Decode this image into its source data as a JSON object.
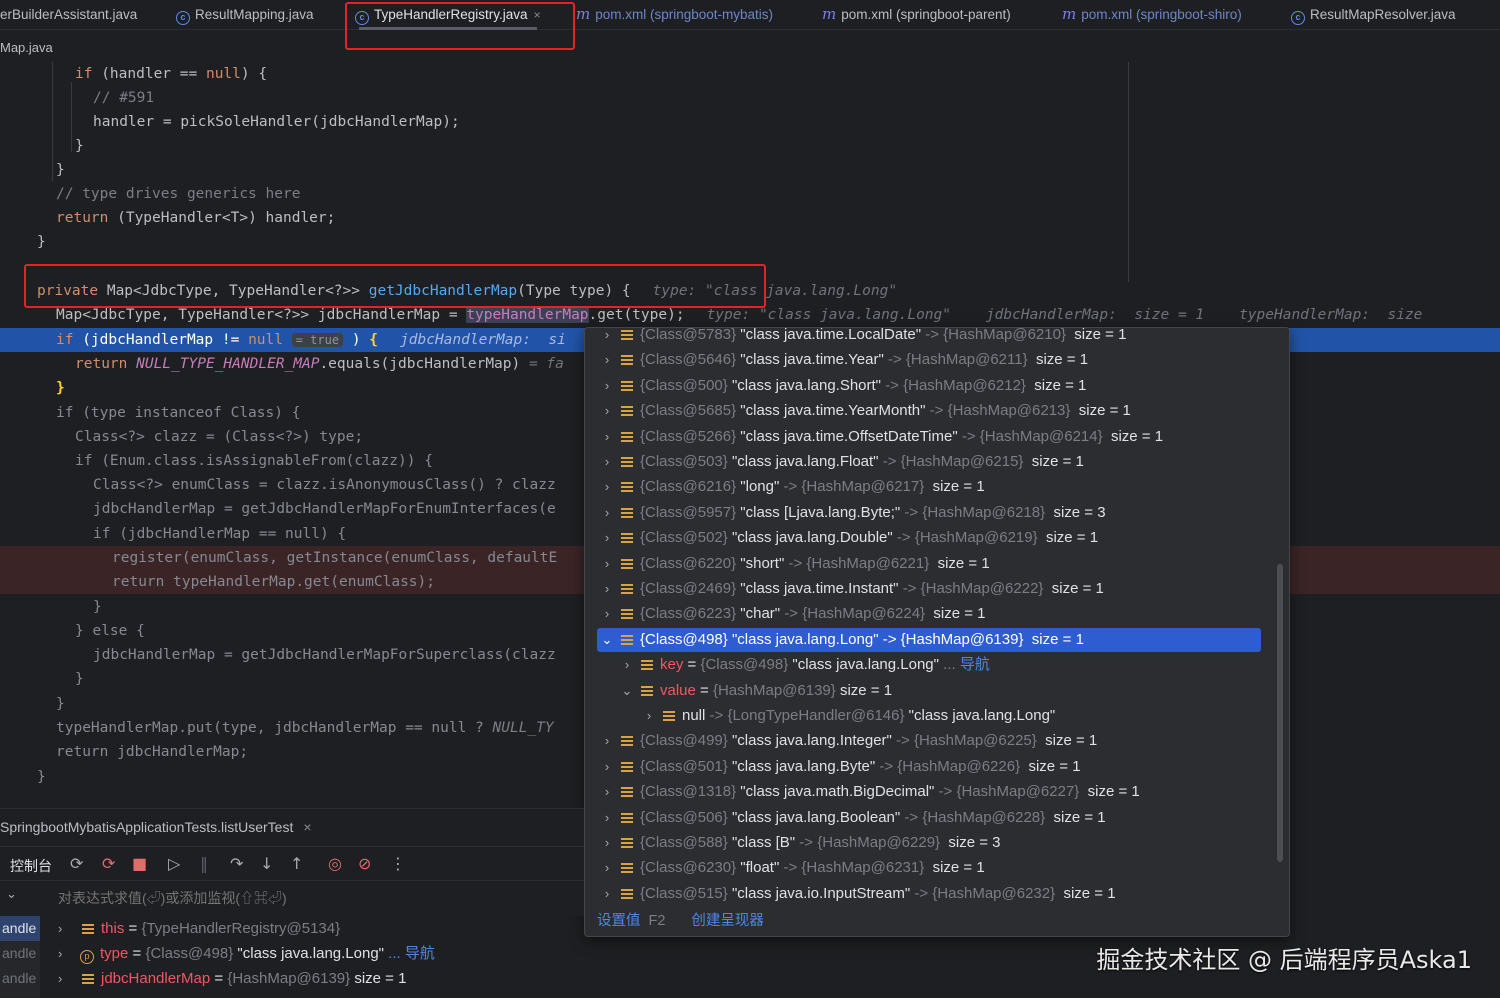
{
  "tabs": [
    {
      "label": "erBuilderAssistant.java",
      "icon": "none"
    },
    {
      "label": "ResultMapping.java",
      "icon": "class-icon"
    },
    {
      "label": "TypeHandlerRegistry.java",
      "icon": "class-icon",
      "active": true
    },
    {
      "label": "pom.xml (springboot-mybatis)",
      "icon": "maven-icon"
    },
    {
      "label": "pom.xml (springboot-parent)",
      "icon": "maven-icon"
    },
    {
      "label": "pom.xml (springboot-shiro)",
      "icon": "maven-icon"
    },
    {
      "label": "ResultMapResolver.java",
      "icon": "class-icon"
    }
  ],
  "tab_close_glyph": "×",
  "breadcrumb": "Map.java",
  "code": {
    "l1": "if (handler == null) {",
    "l2": "// #591",
    "l3": "handler = pickSoleHandler(jdbcHandlerMap);",
    "l4": "}",
    "l5": "}",
    "l6": "// type drives generics here",
    "l7_kw": "return",
    "l7_rest": " (TypeHandler<T>) handler;",
    "l8": "}",
    "sig_kw": "private",
    "sig_type": " Map<JdbcType, TypeHandler<?>> ",
    "sig_fn": "getJdbcHandlerMap",
    "sig_rest": "(Type type) {",
    "sig_hint": "type: \"class java.lang.Long\"",
    "l10_a": "Map<JdbcType, TypeHandler<?>> jdbcHandlerMap = ",
    "l10_field": "typeHandlerMap",
    "l10_b": ".get(type);",
    "l10_hint": "type: \"class java.lang.Long\"    jdbcHandlerMap:  size = 1    typeHandlerMap:  size",
    "l11_a": "if (jdbcHandlerMap != null ",
    "l11_pill": "= true",
    "l11_b": " ) ",
    "l11_brace": "{",
    "l11_hint": "jdbcHandlerMap:  si",
    "l12_kw": "return",
    "l12_field": " NULL_TYPE_HANDLER_MAP",
    "l12_rest": ".equals(jdbcHandlerMap) ",
    "l12_hint": "= fa",
    "l13": "}",
    "l14": "if (type instanceof Class) {",
    "l15": "Class<?> clazz = (Class<?>) type;",
    "l16": "if (Enum.class.isAssignableFrom(clazz)) {",
    "l17": "Class<?> enumClass = clazz.isAnonymousClass() ? clazz",
    "l18": "jdbcHandlerMap = getJdbcHandlerMapForEnumInterfaces(e",
    "l19": "if (jdbcHandlerMap == null) {",
    "l20": "register(enumClass, getInstance(enumClass, defaultE",
    "l21": "return typeHandlerMap.get(enumClass);",
    "l22": "}",
    "l23": "} else {",
    "l24": "jdbcHandlerMap = getJdbcHandlerMapForSuperclass(clazz",
    "l25": "}",
    "l26": "}",
    "l27_a": "typeHandlerMap.put(type, jdbcHandlerMap == null ? ",
    "l27_field": "NULL_TY",
    "l28": "return jdbcHandlerMap;",
    "l29": "}"
  },
  "popup": {
    "rows": [
      {
        "id": "{Class@5783}",
        "name": "\"class java.time.LocalDate\"",
        "arrow": "->",
        "val": "{HashMap@6210}",
        "size": "size = 1"
      },
      {
        "id": "{Class@5646}",
        "name": "\"class java.time.Year\"",
        "arrow": "->",
        "val": "{HashMap@6211}",
        "size": "size = 1"
      },
      {
        "id": "{Class@500}",
        "name": "\"class java.lang.Short\"",
        "arrow": "->",
        "val": "{HashMap@6212}",
        "size": "size = 1"
      },
      {
        "id": "{Class@5685}",
        "name": "\"class java.time.YearMonth\"",
        "arrow": "->",
        "val": "{HashMap@6213}",
        "size": "size = 1"
      },
      {
        "id": "{Class@5266}",
        "name": "\"class java.time.OffsetDateTime\"",
        "arrow": "->",
        "val": "{HashMap@6214}",
        "size": "size = 1"
      },
      {
        "id": "{Class@503}",
        "name": "\"class java.lang.Float\"",
        "arrow": "->",
        "val": "{HashMap@6215}",
        "size": "size = 1"
      },
      {
        "id": "{Class@6216}",
        "name": "\"long\"",
        "arrow": "->",
        "val": "{HashMap@6217}",
        "size": "size = 1"
      },
      {
        "id": "{Class@5957}",
        "name": "\"class [Ljava.lang.Byte;\"",
        "arrow": "->",
        "val": "{HashMap@6218}",
        "size": "size = 3"
      },
      {
        "id": "{Class@502}",
        "name": "\"class java.lang.Double\"",
        "arrow": "->",
        "val": "{HashMap@6219}",
        "size": "size = 1"
      },
      {
        "id": "{Class@6220}",
        "name": "\"short\"",
        "arrow": "->",
        "val": "{HashMap@6221}",
        "size": "size = 1"
      },
      {
        "id": "{Class@2469}",
        "name": "\"class java.time.Instant\"",
        "arrow": "->",
        "val": "{HashMap@6222}",
        "size": "size = 1"
      },
      {
        "id": "{Class@6223}",
        "name": "\"char\"",
        "arrow": "->",
        "val": "{HashMap@6224}",
        "size": "size = 1"
      }
    ],
    "selected": {
      "id": "{Class@498}",
      "name": "\"class java.lang.Long\"",
      "arrow": "->",
      "val": "{HashMap@6139}",
      "size": "size = 1"
    },
    "key_row": {
      "label": "key",
      "eq": " = ",
      "id": "{Class@498}",
      "name": " \"class java.lang.Long\"",
      "dots": " ...",
      "nav": " 导航"
    },
    "value_row": {
      "label": "value",
      "eq": " = ",
      "id": "{HashMap@6139}",
      "size": "  size = 1"
    },
    "null_row": {
      "label": "null",
      "arrow": " -> ",
      "id": "{LongTypeHandler@6146}",
      "name": " \"class java.lang.Long\""
    },
    "rows_after": [
      {
        "id": "{Class@499}",
        "name": "\"class java.lang.Integer\"",
        "arrow": "->",
        "val": "{HashMap@6225}",
        "size": "size = 1"
      },
      {
        "id": "{Class@501}",
        "name": "\"class java.lang.Byte\"",
        "arrow": "->",
        "val": "{HashMap@6226}",
        "size": "size = 1"
      },
      {
        "id": "{Class@1318}",
        "name": "\"class java.math.BigDecimal\"",
        "arrow": "->",
        "val": "{HashMap@6227}",
        "size": "size = 1"
      },
      {
        "id": "{Class@506}",
        "name": "\"class java.lang.Boolean\"",
        "arrow": "->",
        "val": "{HashMap@6228}",
        "size": "size = 1"
      },
      {
        "id": "{Class@588}",
        "name": "\"class [B\"",
        "arrow": "->",
        "val": "{HashMap@6229}",
        "size": "size = 3"
      },
      {
        "id": "{Class@6230}",
        "name": "\"float\"",
        "arrow": "->",
        "val": "{HashMap@6231}",
        "size": "size = 1"
      },
      {
        "id": "{Class@515}",
        "name": "\"class java.io.InputStream\"",
        "arrow": "->",
        "val": "{HashMap@6232}",
        "size": "size = 1"
      }
    ],
    "footer": {
      "set_value": "设置值",
      "set_value_key": "F2",
      "create_renderer": "创建呈现器"
    }
  },
  "debug": {
    "session_tab": "SpringbootMybatisApplicationTests.listUserTest",
    "console_label": "控制台",
    "expr_placeholder": "对表达式求值(⏎)或添加监视(⇧⌘⏎)",
    "frames": [
      "andle",
      "andle",
      "andle"
    ],
    "vars": [
      {
        "name": "this",
        "eq": " = ",
        "id": "{TypeHandlerRegistry@5134}",
        "rest": ""
      },
      {
        "name": "type",
        "eq": " = ",
        "id": "{Class@498}",
        "rest": " \"class java.lang.Long\"",
        "nav": " ... 导航"
      },
      {
        "name": "jdbcHandlerMap",
        "eq": " = ",
        "id": "{HashMap@6139}",
        "rest": "  size = 1"
      }
    ]
  },
  "watermark": "掘金技术社区 @ 后端程序员Aska1",
  "colors": {
    "highlight_box": "#e0242b",
    "selection": "#2e5cd1",
    "exec_line": "#2154a8"
  }
}
